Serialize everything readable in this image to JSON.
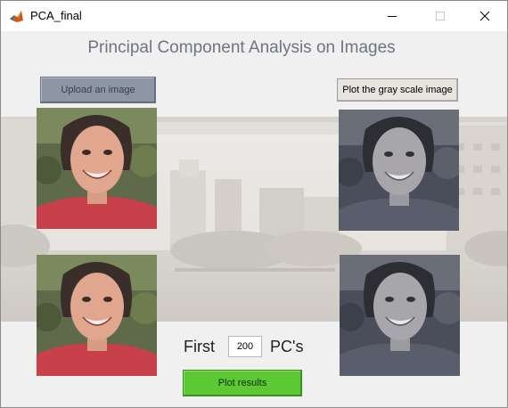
{
  "window": {
    "title": "PCA_final",
    "controls": {
      "minimize_icon": "minimize-icon",
      "maximize_icon": "maximize-icon",
      "close_icon": "close-icon"
    }
  },
  "main": {
    "heading": "Principal Component Analysis on Images",
    "upload_button": "Upload an image",
    "gray_button": "Plot the gray scale image",
    "first_label": "First",
    "pc_count_value": "200",
    "pcs_label": "PC's",
    "plot_button": "Plot results"
  },
  "images": [
    {
      "name": "original-color-image",
      "tone": "color"
    },
    {
      "name": "grayscale-image",
      "tone": "gray"
    },
    {
      "name": "reconstructed-color-image",
      "tone": "color"
    },
    {
      "name": "reconstructed-gray-image",
      "tone": "gray"
    }
  ],
  "colors": {
    "upload_button_bg": "#8e96a5",
    "plot_button_bg": "#5cc832",
    "heading_color": "#6f7480",
    "shirt_red": "#c8404a"
  }
}
